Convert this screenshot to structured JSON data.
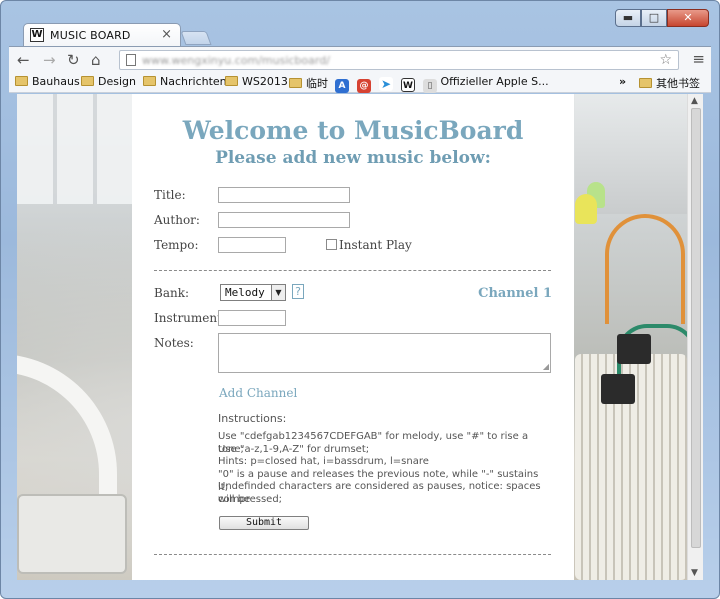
{
  "browser": {
    "tab_title": "MUSIC BOARD",
    "tab_favicon_letter": "W",
    "url": "www.wengxinyu.com/musicboard/",
    "window_buttons": {
      "minimize": "▬",
      "maximize": "□",
      "close": "✕"
    },
    "bookmarks": [
      {
        "label": "Bauhaus",
        "icon": "folder-icon"
      },
      {
        "label": "Design",
        "icon": "folder-icon"
      },
      {
        "label": "Nachrichten",
        "icon": "folder-icon"
      },
      {
        "label": "WS2013",
        "icon": "folder-icon"
      },
      {
        "label": "临时",
        "icon": "folder-icon"
      },
      {
        "label": "",
        "icon": "app-store-icon"
      },
      {
        "label": "",
        "icon": "swirl-icon"
      },
      {
        "label": "",
        "icon": "bird-icon"
      },
      {
        "label": "",
        "icon": "w-icon"
      },
      {
        "label": "Offizieller Apple S...",
        "icon": "apple-page-icon"
      },
      {
        "label": "»",
        "icon": "overflow-chevron-icon"
      },
      {
        "label": "其他书签",
        "icon": "folder-icon"
      }
    ]
  },
  "page": {
    "heading": "Welcome to MusicBoard",
    "subheading": "Please add new music below:",
    "fields": {
      "title_label": "Title:",
      "author_label": "Author:",
      "tempo_label": "Tempo:",
      "instant_play_label": "Instant Play",
      "title_value": "",
      "author_value": "",
      "tempo_value": ""
    },
    "channel": {
      "bank_label": "Bank:",
      "bank_selected": "Melody",
      "help_label": "?",
      "channel_title": "Channel 1",
      "instrument_label": "Instrument:",
      "notes_label": "Notes:",
      "instrument_value": "",
      "notes_value": ""
    },
    "add_channel_label": "Add Channel",
    "instructions": {
      "title": "Instructions:",
      "lines": [
        "Use \"cdefgab1234567CDEFGAB\" for melody, use \"#\" to rise a tone;",
        "Use \"a-z,1-9,A-Z\" for drumset;",
        "Hints: p=closed hat, i=bassdrum, l=snare",
        "\"0\" is a pause and releases the previous note, while \"-\" sustains it;",
        "Undefinded characters are considered as pauses, notice: spaces will be",
        "compressed;"
      ]
    },
    "submit_label": "Submit"
  }
}
